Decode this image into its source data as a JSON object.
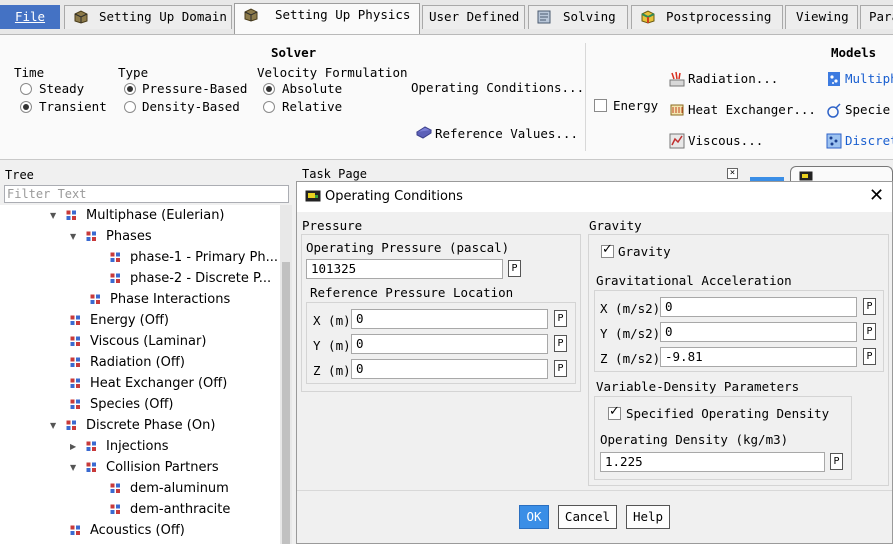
{
  "tabs": {
    "file": "File",
    "domain": "Setting Up Domain",
    "physics": "Setting Up Physics",
    "user_defined": "User Defined",
    "solving": "Solving",
    "postprocessing": "Postprocessing",
    "viewing": "Viewing",
    "parallel": "Para"
  },
  "ribbon": {
    "solver": {
      "title": "Solver",
      "time_label": "Time",
      "time_steady": "Steady",
      "time_transient": "Transient",
      "type_label": "Type",
      "type_pressure": "Pressure-Based",
      "type_density": "Density-Based",
      "velocity_label": "Velocity Formulation",
      "vel_absolute": "Absolute",
      "vel_relative": "Relative",
      "operating_conditions": "Operating Conditions...",
      "reference_values": "Reference Values..."
    },
    "models": {
      "title": "Models",
      "energy": "Energy",
      "radiation": "Radiation...",
      "heat_exchanger": "Heat Exchanger...",
      "viscous": "Viscous...",
      "multiphase": "Multiph",
      "species": "Specie",
      "discrete": "Discret"
    }
  },
  "tree": {
    "header": "Tree",
    "filter_placeholder": "Filter Text",
    "items": [
      {
        "label": "Multiphase (Eulerian)"
      },
      {
        "label": "Phases"
      },
      {
        "label": "phase-1 - Primary Ph..."
      },
      {
        "label": "phase-2 - Discrete P..."
      },
      {
        "label": "Phase Interactions"
      },
      {
        "label": "Energy (Off)"
      },
      {
        "label": "Viscous (Laminar)"
      },
      {
        "label": "Radiation (Off)"
      },
      {
        "label": "Heat Exchanger (Off)"
      },
      {
        "label": "Species (Off)"
      },
      {
        "label": "Discrete Phase (On)"
      },
      {
        "label": "Injections"
      },
      {
        "label": "Collision Partners"
      },
      {
        "label": "dem-aluminum"
      },
      {
        "label": "dem-anthracite"
      },
      {
        "label": "Acoustics (Off)"
      }
    ]
  },
  "task_page": {
    "header": "Task Page"
  },
  "dialog": {
    "title": "Operating Conditions",
    "pressure": {
      "title": "Pressure",
      "operating_pressure_label": "Operating Pressure (pascal)",
      "operating_pressure_value": "101325",
      "ref_location_title": "Reference Pressure Location",
      "x_label": "X (m)",
      "x_value": "0",
      "y_label": "Y (m)",
      "y_value": "0",
      "z_label": "Z (m)",
      "z_value": "0"
    },
    "gravity": {
      "title": "Gravity",
      "gravity_checkbox": "Gravity",
      "accel_title": "Gravitational Acceleration",
      "x_label": "X (m/s2)",
      "x_value": "0",
      "y_label": "Y (m/s2)",
      "y_value": "0",
      "z_label": "Z (m/s2)",
      "z_value": "-9.81"
    },
    "variable_density": {
      "title": "Variable-Density Parameters",
      "specified_checkbox": "Specified Operating Density",
      "density_label": "Operating Density (kg/m3)",
      "density_value": "1.225"
    },
    "p_button": "P",
    "buttons": {
      "ok": "OK",
      "cancel": "Cancel",
      "help": "Help"
    }
  },
  "colors": {
    "file_tab": "#4472c4",
    "ok_button": "#3a8ee6"
  }
}
